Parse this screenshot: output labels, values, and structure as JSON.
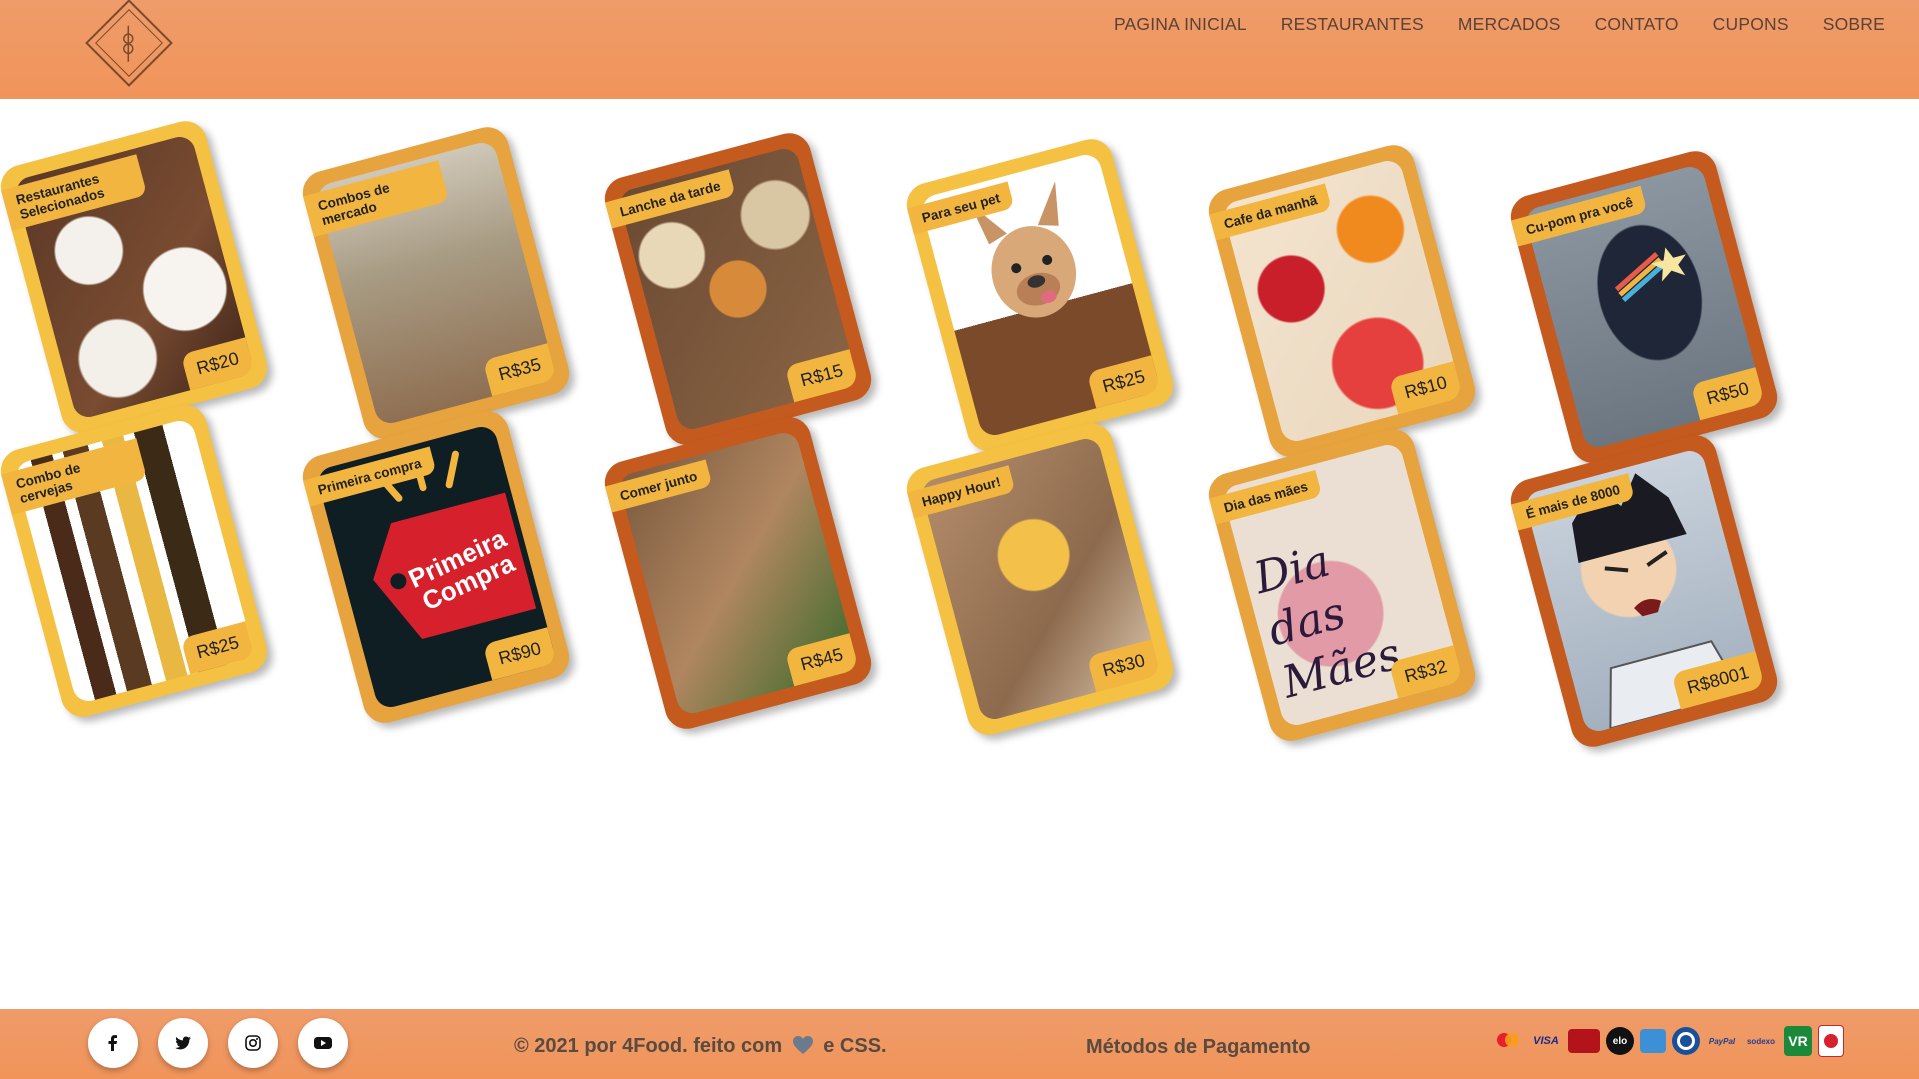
{
  "nav": {
    "items": [
      "PAGINA INICIAL",
      "RESTAURANTES",
      "MERCADOS",
      "CONTATO",
      "CUPONS",
      "SOBRE"
    ]
  },
  "cards": [
    {
      "tag": "Restaurantes Selecionados",
      "price": "R$20",
      "color": "#f5c142",
      "image": "restaurant-dishes"
    },
    {
      "tag": "Combos de mercado",
      "price": "R$35",
      "color": "#e6a33e",
      "image": "market-shopper"
    },
    {
      "tag": "Lanche da tarde",
      "price": "R$15",
      "color": "#c55a1f",
      "image": "afternoon-snack"
    },
    {
      "tag": "Para seu pet",
      "price": "R$25",
      "color": "#f5c142",
      "image": "french-bulldog"
    },
    {
      "tag": "Cafe da manhã",
      "price": "R$10",
      "color": "#e6a33e",
      "image": "breakfast"
    },
    {
      "tag": "Cu-pom pra você",
      "price": "R$50",
      "color": "#c55a1f",
      "image": "t-shirt"
    },
    {
      "tag": "Combo de cervejas",
      "price": "R$25",
      "color": "#f5c142",
      "image": "beer-bottles"
    },
    {
      "tag": "Primeira compra",
      "price": "R$90",
      "color": "#e6a33e",
      "image": "primeira-compra-tag",
      "image_text": "Primeira Compra"
    },
    {
      "tag": "Comer junto",
      "price": "R$45",
      "color": "#c55a1f",
      "image": "family-eating"
    },
    {
      "tag": "Happy Hour!",
      "price": "R$30",
      "color": "#f5c142",
      "image": "beer-toast"
    },
    {
      "tag": "Dia das mães",
      "price": "R$32",
      "color": "#e6a33e",
      "image": "dia-das-maes",
      "image_text": "Dia das Mães"
    },
    {
      "tag": "É mais de 8000",
      "price": "R$8001",
      "color": "#c55a1f",
      "image": "vegeta"
    }
  ],
  "footer": {
    "social": [
      "facebook-icon",
      "twitter-icon",
      "instagram-icon",
      "youtube-icon"
    ],
    "copyright_prefix": "© 2021 por 4Food. feito com",
    "copyright_suffix": "e CSS.",
    "payment_title": "Métodos de Pagamento",
    "payment_methods": [
      "Mastercard",
      "VISA",
      "Hipercard",
      "elo",
      "Amex",
      "Diners",
      "PayPal",
      "sodexo",
      "VR",
      "Ticket"
    ]
  }
}
